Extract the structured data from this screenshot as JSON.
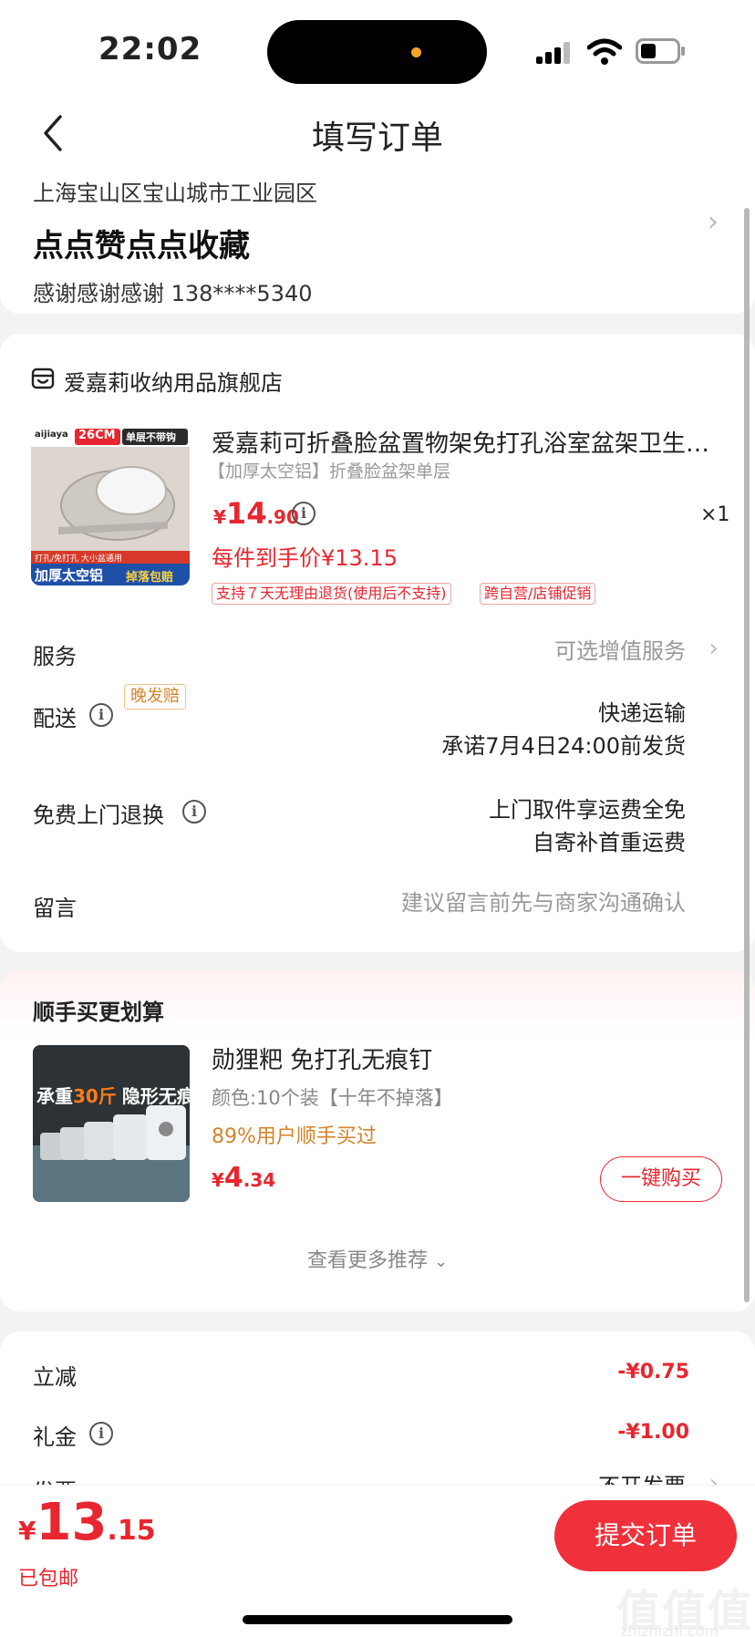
{
  "status_bar": {
    "time": "22:02"
  },
  "header": {
    "title": "填写订单"
  },
  "address": {
    "line": "上海宝山区宝山城市工业园区",
    "name": "点点赞点点收藏",
    "contact": "感谢感谢感谢 138****5340"
  },
  "store": {
    "name": "爱嘉莉收纳用品旗舰店",
    "product": {
      "title": "爱嘉莉可折叠脸盆置物架免打孔浴室盆架卫生间...",
      "spec": "【加厚太空铝】折叠脸盆架单层",
      "price_currency": "¥",
      "price_int": "14",
      "price_dec": ".90",
      "qty": "×1",
      "final_price": "每件到手价¥13.15",
      "tags": [
        "支持７天无理由退货(使用后不支持)",
        "跨自营/店铺促销"
      ],
      "image_texts": {
        "brand": "aijiaya",
        "size": "26CM",
        "hook": "单层不带钩",
        "small": "打孔/免打孔 大小盆通用",
        "banner": "加厚太空铝",
        "banner2": "掉落包赔"
      }
    }
  },
  "rows": {
    "service_label": "服务",
    "service_value": "可选增值服务",
    "delivery_label": "配送",
    "delivery_tag": "晚发赔",
    "delivery_method": "快递运输",
    "delivery_promise": "承诺7月4日24:00前发货",
    "return_label": "免费上门退换",
    "return_line1": "上门取件享运费全免",
    "return_line2": "自寄补首重运费",
    "note_label": "留言",
    "note_placeholder": "建议留言前先与商家沟通确认"
  },
  "recommend": {
    "title": "顺手买更划算",
    "name": "勋狸粑 免打孔无痕钉",
    "spec": "颜色:10个装【十年不掉落】",
    "bought": "89%用户顺手买过",
    "price_currency": "¥",
    "price_int": "4",
    "price_dec": ".34",
    "buy_label": "一键购买",
    "more_label": "查看更多推荐",
    "image_texts": {
      "line1": "承重",
      "highlight": "30斤",
      "line2": "隐形无痕"
    }
  },
  "discounts": {
    "items": [
      {
        "label": "立减",
        "amount": "-¥0.75"
      },
      {
        "label": "礼金",
        "amount": "-¥1.00"
      },
      {
        "label": "发票",
        "value": "不开发票"
      }
    ]
  },
  "bottom_bar": {
    "total_currency": "¥",
    "total_int": "13",
    "total_dec": ".15",
    "shipping": "已包邮",
    "submit_label": "提交订单"
  },
  "watermark": {
    "main": "值值值",
    "sub": "zhizhizhi.com"
  },
  "colors": {
    "accent": "#e8262f",
    "submit": "#f0303a",
    "orange": "#d4832a"
  },
  "icons": [
    "back-icon",
    "store-icon",
    "info-icon",
    "chevron-right-icon",
    "chevron-down-icon"
  ]
}
